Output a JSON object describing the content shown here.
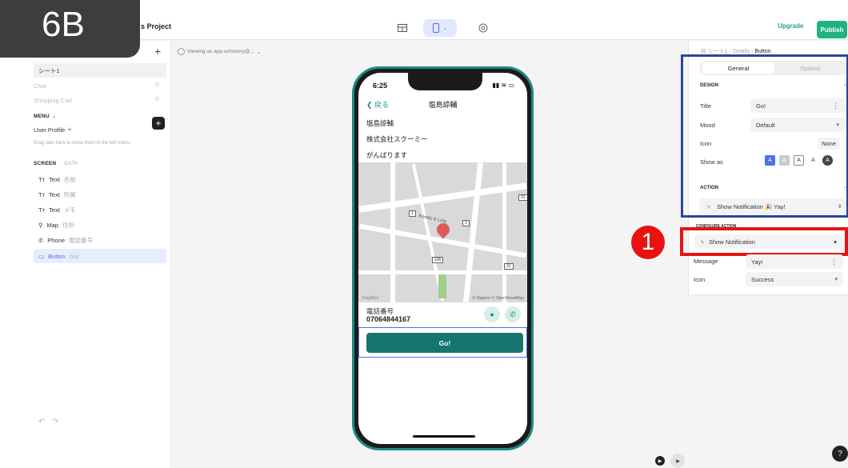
{
  "slide_tag": "6B",
  "project_title": "s Project",
  "toolbar": {
    "upgrade": "Upgrade",
    "publish": "Publish"
  },
  "left": {
    "tabs": [
      {
        "label": "シート1"
      },
      {
        "label": "Chat"
      },
      {
        "label": "Shopping Cart"
      }
    ],
    "menu_header": "MENU",
    "user_profile": "User Profile",
    "drag_hint": "Drag tabs here to show them in the left menu.",
    "screen_tab": "SCREEN",
    "data_tab": "DATA",
    "components": [
      {
        "icon": "Tт",
        "label": "Text",
        "sub": "名前"
      },
      {
        "icon": "Tт",
        "label": "Text",
        "sub": "所属"
      },
      {
        "icon": "Tт",
        "label": "Text",
        "sub": "メモ"
      },
      {
        "icon": "⚲",
        "label": "Map",
        "sub": "住所"
      },
      {
        "icon": "✆",
        "label": "Phone",
        "sub": "電話番号"
      },
      {
        "icon": "▭",
        "label": "Button",
        "sub": "Go!"
      }
    ]
  },
  "viewing": "Viewing as app.schoomy@...",
  "phone": {
    "time": "6:25",
    "back": "戻る",
    "title": "塩島諒輔",
    "texts": [
      "塩島諒輔",
      "株式会社スクーミー",
      "がんばります"
    ],
    "map_credit": "© Mapbox © OpenStreetMap",
    "map_logo": "mapbox",
    "street": "Kendo 6 Line",
    "phone_label": "電話番号",
    "phone_number": "07064844167",
    "button": "Go!"
  },
  "right": {
    "crumbs": [
      "シート1",
      "Details",
      "Button"
    ],
    "seg_general": "General",
    "seg_options": "Options",
    "design_head": "DESIGN",
    "title_label": "Title",
    "title_value": "Go!",
    "mood_label": "Mood",
    "mood_value": "Default",
    "icon_label": "Icon",
    "icon_value": "None",
    "showas_label": "Show as",
    "action_head": "ACTION",
    "action_value": "Show Notification 🎉 Yay!",
    "configure_head": "CONFIGURE ACTION",
    "notif_value": "Show Notification",
    "message_label": "Message",
    "message_value": "Yay!",
    "icon2_label": "Icon",
    "icon2_value": "Success"
  },
  "annotation_number": "1",
  "colors": {
    "teal": "#16756f",
    "accent": "#4f6ef0",
    "red": "#e71313",
    "navy": "#27479a",
    "publish": "#21b27e"
  }
}
